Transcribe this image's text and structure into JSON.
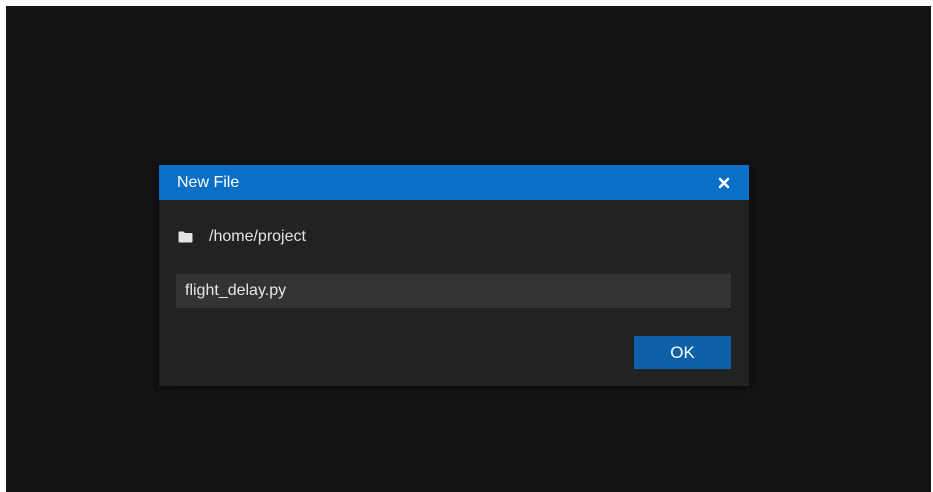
{
  "dialog": {
    "title": "New File",
    "close_icon": "close-icon",
    "folder_icon": "folder-icon",
    "path": "/home/project",
    "filename_value": "flight_delay.py",
    "ok_label": "OK"
  },
  "colors": {
    "background": "#141416",
    "dialog_body": "#222224",
    "titlebar": "#0a6fc7",
    "input_background": "#333335",
    "ok_button": "#0d60a8"
  }
}
